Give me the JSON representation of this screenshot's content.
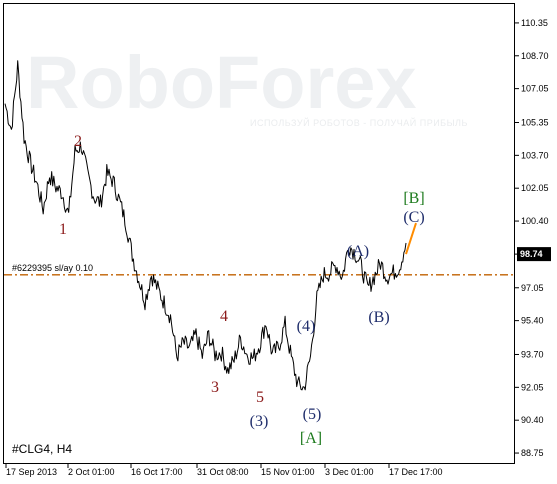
{
  "chart_data": {
    "type": "line",
    "symbol_label": "#CLG4, H4",
    "current_price": "98.74",
    "level_line": {
      "label": "#6229395 sl/ay 0.10",
      "value": 97.7,
      "color": "#c06000"
    },
    "ylim": [
      88.2,
      111.3
    ],
    "y_ticks": [
      "110.35",
      "108.70",
      "107.05",
      "105.35",
      "103.70",
      "102.05",
      "100.40",
      "98.74",
      "97.05",
      "95.40",
      "93.70",
      "92.05",
      "90.40",
      "88.75"
    ],
    "x_ticks": [
      "17 Sep 2013",
      "2 Oct 01:00",
      "16 Oct 17:00",
      "31 Oct 08:00",
      "15 Nov 01:00",
      "3 Dec 01:00",
      "17 Dec 17:00"
    ],
    "series": [
      {
        "values": [
          106.3,
          105.0,
          108.2,
          104.6,
          103.3,
          102.3,
          101.0,
          102.7,
          102.1,
          101.8,
          100.7,
          103.9,
          104.2,
          102.7,
          101.6,
          101.3,
          102.8,
          102.4,
          101.4,
          100.3,
          98.7,
          97.5,
          96.4,
          97.7,
          97.0,
          96.3,
          95.6,
          93.6,
          94.3,
          94.0,
          94.7,
          93.6,
          94.7,
          93.7,
          93.8,
          92.9,
          93.4,
          94.5,
          93.7,
          93.5,
          94.2,
          95.3,
          93.7,
          94.1,
          95.2,
          93.5,
          92.2,
          92.0,
          93.6,
          96.5,
          97.7,
          97.8,
          98.2,
          97.6,
          99.2,
          98.8,
          98.1,
          97.0,
          97.6,
          98.3,
          97.6,
          97.8,
          98.1,
          99.3
        ]
      },
      {
        "values": [
          98.74,
          100.3
        ]
      }
    ],
    "wave_labels": [
      {
        "text": "1",
        "color": "#8b1a1a"
      },
      {
        "text": "2",
        "color": "#8b1a1a"
      },
      {
        "text": "3",
        "color": "#8b1a1a"
      },
      {
        "text": "4",
        "color": "#8b1a1a"
      },
      {
        "text": "5",
        "color": "#8b1a1a"
      },
      {
        "text": "(3)",
        "color": "#1f2d6b"
      },
      {
        "text": "(4)",
        "color": "#1f2d6b"
      },
      {
        "text": "(5)",
        "color": "#1f2d6b"
      },
      {
        "text": "[A]",
        "color": "#1e7b1e"
      },
      {
        "text": "(A)",
        "color": "#1f2d6b"
      },
      {
        "text": "(B)",
        "color": "#1f2d6b"
      },
      {
        "text": "(C)",
        "color": "#1f2d6b"
      },
      {
        "text": "[B]",
        "color": "#1e7b1e"
      }
    ],
    "watermark": {
      "logo": "RoboForex",
      "tagline": "ИСПОЛЬЗУЙ РОБОТОВ - ПОЛУЧАЙ ПРИБЫЛЬ"
    },
    "colors": {
      "price": "#000000",
      "projection": "#ff8c00",
      "price_tag_bg": "#000000"
    },
    "grid": false
  }
}
